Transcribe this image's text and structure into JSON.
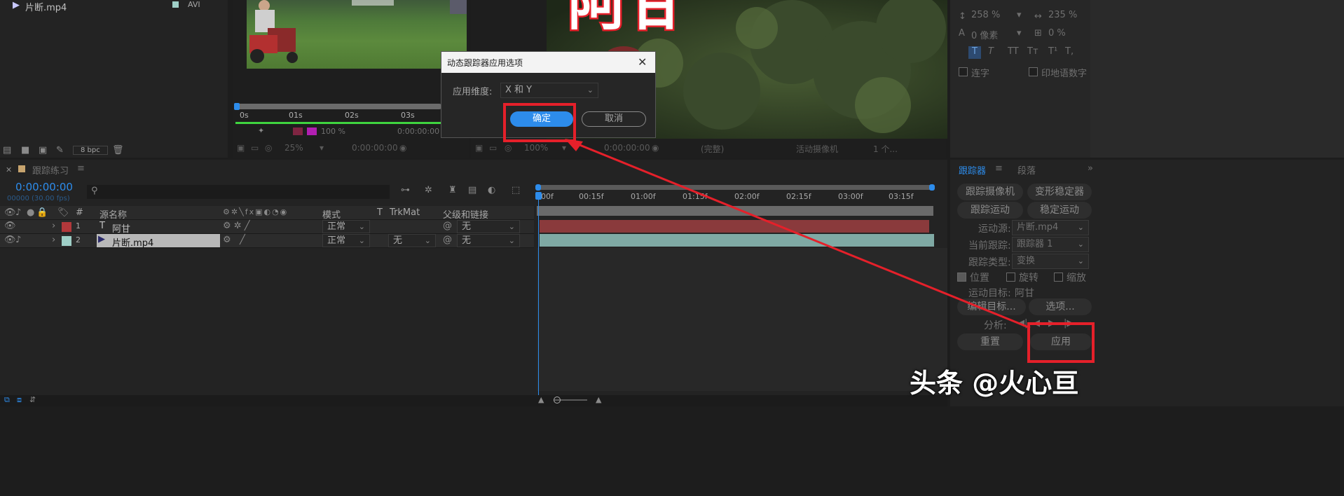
{
  "project": {
    "file_name": "片断.mp4",
    "file_type": "AVI",
    "bpc": "8 bpc"
  },
  "viewer_left": {
    "ruler": [
      "0s",
      "01s",
      "02s",
      "03s"
    ],
    "zoom": "25%",
    "timecode": "0:00:00:00",
    "percent": "100 %",
    "timecode2": "0:00:00:00"
  },
  "viewer_right": {
    "zoom": "100%",
    "timecode": "0:00:00:00",
    "quality": "(完整)",
    "camera": "活动摄像机",
    "views": "1 个..."
  },
  "dialog": {
    "title": "动态跟踪器应用选项",
    "dimension_label": "应用维度:",
    "dimension_value": "X 和 Y",
    "ok_label": "确定",
    "cancel_label": "取消"
  },
  "timeline": {
    "tab_label": "跟踪练习",
    "timecode": "0:00:00:00",
    "frame_info": "00000 (30.00 fps)",
    "search_placeholder": "",
    "columns": {
      "hash": "#",
      "source_name": "源名称",
      "mode": "模式",
      "t": "T",
      "trkmat": "TrkMat",
      "parent": "父级和链接"
    },
    "ruler": [
      "00f",
      "00:15f",
      "01:00f",
      "01:15f",
      "02:00f",
      "02:15f",
      "03:00f",
      "03:15f"
    ],
    "layers": [
      {
        "num": "1",
        "name": "阿甘",
        "mode": "正常",
        "trkmat": "",
        "parent": "无",
        "color": "#b2383b"
      },
      {
        "num": "2",
        "name": "片断.mp4",
        "mode": "正常",
        "trkmat": "无",
        "parent": "无",
        "color": "#9fcfc7"
      }
    ]
  },
  "character": {
    "leading": "258 %",
    "tracking": "235 %",
    "baseline": "0 像素",
    "tsume": "0 %",
    "ligature_label": "连字",
    "hindi_label": "印地语数字",
    "style_buttons": [
      "T",
      "T",
      "TT",
      "Tт",
      "T¹",
      "T,"
    ]
  },
  "tracker": {
    "tab_tracker": "跟踪器",
    "tab_paragraph": "段落",
    "btn_track_camera": "跟踪摄像机",
    "btn_warp_stabilizer": "变形稳定器",
    "btn_track_motion": "跟踪运动",
    "btn_stabilize_motion": "稳定运动",
    "motion_source_label": "运动源:",
    "motion_source_value": "片断.mp4",
    "current_track_label": "当前跟踪:",
    "current_track_value": "跟踪器 1",
    "track_type_label": "跟踪类型:",
    "track_type_value": "变换",
    "position_label": "位置",
    "rotation_label": "旋转",
    "scale_label": "缩放",
    "motion_target_label": "运动目标:",
    "motion_target_value": "阿甘",
    "edit_target_label": "编辑目标...",
    "options_label": "选项...",
    "analyze_label": "分析:",
    "reset_label": "重置",
    "apply_label": "应用"
  },
  "watermark": "头条 @火心亘",
  "comp_overlay_text": "阿甘",
  "colors": {
    "accent_blue": "#2d8ceb",
    "annotation_red": "#e5202a",
    "layer1_color": "#b2383b",
    "layer2_color": "#9fcfc7"
  }
}
